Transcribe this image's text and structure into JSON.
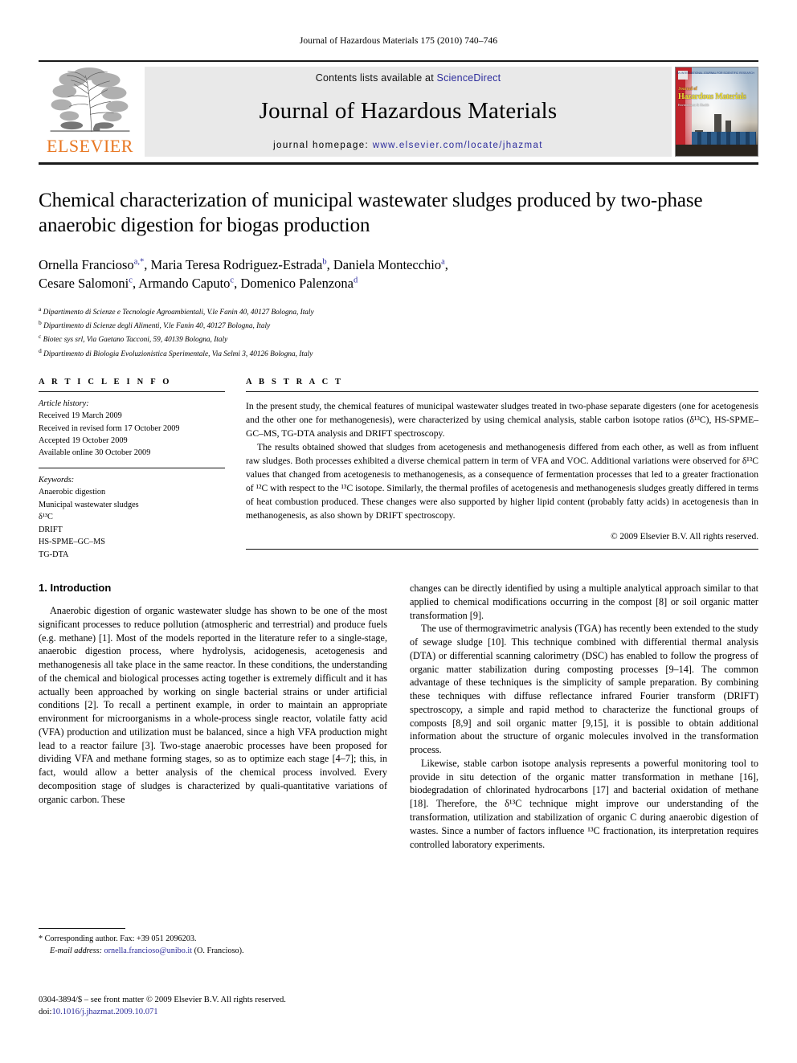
{
  "running_head": "Journal of Hazardous Materials 175 (2010) 740–746",
  "masthead": {
    "publisher_name": "ELSEVIER",
    "contents_prefix": "Contents lists available at ",
    "sciencedirect": "ScienceDirect",
    "journal_name": "Journal of Hazardous Materials",
    "homepage_prefix": "journal homepage: ",
    "homepage_url": "www.elsevier.com/locate/jhazmat",
    "cover": {
      "line1": "Journal of",
      "line2": "Hazardous",
      "line3": "Materials",
      "line4": "AN INTERNATIONAL JOURNAL FOR SCIENTIFIC RESEARCH",
      "line5": "Environment & Health"
    },
    "accent_orange": "#E87722",
    "link_blue": "#2c2c9c",
    "cover_red": "#c0232b",
    "band_gray": "#e9e9e9"
  },
  "article": {
    "title": "Chemical characterization of municipal wastewater sludges produced by two-phase anaerobic digestion for biogas production",
    "authors_line1": "Ornella Francioso",
    "authors": [
      {
        "name": "Ornella Francioso",
        "marks": "a,*"
      },
      {
        "name": "Maria Teresa Rodriguez-Estrada",
        "marks": "b"
      },
      {
        "name": "Daniela Montecchio",
        "marks": "a"
      },
      {
        "name": "Cesare Salomoni",
        "marks": "c"
      },
      {
        "name": "Armando Caputo",
        "marks": "c"
      },
      {
        "name": "Domenico Palenzona",
        "marks": "d"
      }
    ],
    "affiliations": [
      {
        "mark": "a",
        "text": "Dipartimento di Scienze e Tecnologie Agroambientali, V.le Fanin 40, 40127 Bologna, Italy"
      },
      {
        "mark": "b",
        "text": "Dipartimento di Scienze degli Alimenti, V.le Fanin 40, 40127 Bologna, Italy"
      },
      {
        "mark": "c",
        "text": "Biotec sys srl, Via Gaetano Tacconi, 59, 40139 Bologna, Italy"
      },
      {
        "mark": "d",
        "text": "Dipartimento di Biologia Evoluzionistica Sperimentale, Via Selmi 3, 40126 Bologna, Italy"
      }
    ]
  },
  "article_info": {
    "heading": "A R T I C L E   I N F O",
    "history_label": "Article history:",
    "history": [
      "Received 19 March 2009",
      "Received in revised form 17 October 2009",
      "Accepted 19 October 2009",
      "Available online 30 October 2009"
    ],
    "keywords_label": "Keywords:",
    "keywords": [
      "Anaerobic digestion",
      "Municipal wastewater sludges",
      "δ¹³C",
      "DRIFT",
      "HS-SPME–GC–MS",
      "TG-DTA"
    ]
  },
  "abstract": {
    "heading": "A B S T R A C T",
    "paragraph1": "In the present study, the chemical features of municipal wastewater sludges treated in two-phase separate digesters (one for acetogenesis and the other one for methanogenesis), were characterized by using chemical analysis, stable carbon isotope ratios (δ¹³C), HS-SPME–GC–MS, TG-DTA analysis and DRIFT spectroscopy.",
    "paragraph2": "The results obtained showed that sludges from acetogenesis and methanogenesis differed from each other, as well as from influent raw sludges. Both processes exhibited a diverse chemical pattern in term of VFA and VOC. Additional variations were observed for δ¹³C values that changed from acetogenesis to methanogenesis, as a consequence of fermentation processes that led to a greater fractionation of ¹²C with respect to the ¹³C isotope. Similarly, the thermal profiles of acetogenesis and methanogenesis sludges greatly differed in terms of heat combustion produced. These changes were also supported by higher lipid content (probably fatty acids) in acetogenesis than in methanogenesis, as also shown by DRIFT spectroscopy.",
    "copyright": "© 2009 Elsevier B.V. All rights reserved."
  },
  "introduction": {
    "heading": "1.  Introduction",
    "left_p1": "Anaerobic digestion of organic wastewater sludge has shown to be one of the most significant processes to reduce pollution (atmospheric and terrestrial) and produce fuels (e.g. methane) [1]. Most of the models reported in the literature refer to a single-stage, anaerobic digestion process, where hydrolysis, acidogenesis, acetogenesis and methanogenesis all take place in the same reactor. In these conditions, the understanding of the chemical and biological processes acting together is extremely difficult and it has actually been approached by working on single bacterial strains or under artificial conditions [2]. To recall a pertinent example, in order to maintain an appropriate environment for microorganisms in a whole-process single reactor, volatile fatty acid (VFA) production and utilization must be balanced, since a high VFA production might lead to a reactor failure [3]. Two-stage anaerobic processes have been proposed for dividing VFA and methane forming stages, so as to optimize each stage [4–7]; this, in fact, would allow a better analysis of the chemical process involved. Every decomposition stage of sludges is characterized by quali-quantitative variations of organic carbon. These",
    "right_p1": "changes can be directly identified by using a multiple analytical approach similar to that applied to chemical modifications occurring in the compost [8] or soil organic matter transformation [9].",
    "right_p2": "The use of thermogravimetric analysis (TGA) has recently been extended to the study of sewage sludge [10]. This technique combined with differential thermal analysis (DTA) or differential scanning calorimetry (DSC) has enabled to follow the progress of organic matter stabilization during composting processes [9–14]. The common advantage of these techniques is the simplicity of sample preparation. By combining these techniques with diffuse reflectance infrared Fourier transform (DRIFT) spectroscopy, a simple and rapid method to characterize the functional groups of composts [8,9] and soil organic matter [9,15], it is possible to obtain additional information about the structure of organic molecules involved in the transformation process.",
    "right_p3": "Likewise, stable carbon isotope analysis represents a powerful monitoring tool to provide in situ detection of the organic matter transformation in methane [16], biodegradation of chlorinated hydrocarbons [17] and bacterial oxidation of methane [18]. Therefore, the δ¹³C technique might improve our understanding of the transformation, utilization and stabilization of organic C during anaerobic digestion of wastes. Since a number of factors influence ¹³C fractionation, its interpretation requires controlled laboratory experiments."
  },
  "footnote": {
    "corresponding": "*  Corresponding author. Fax: +39 051 2096203.",
    "email_label": "E-mail address:",
    "email": "ornella.francioso@unibo.it",
    "email_suffix": "(O. Francioso)."
  },
  "imprint": {
    "line1": "0304-3894/$ – see front matter © 2009 Elsevier B.V. All rights reserved.",
    "doi_label": "doi:",
    "doi": "10.1016/j.jhazmat.2009.10.071"
  }
}
